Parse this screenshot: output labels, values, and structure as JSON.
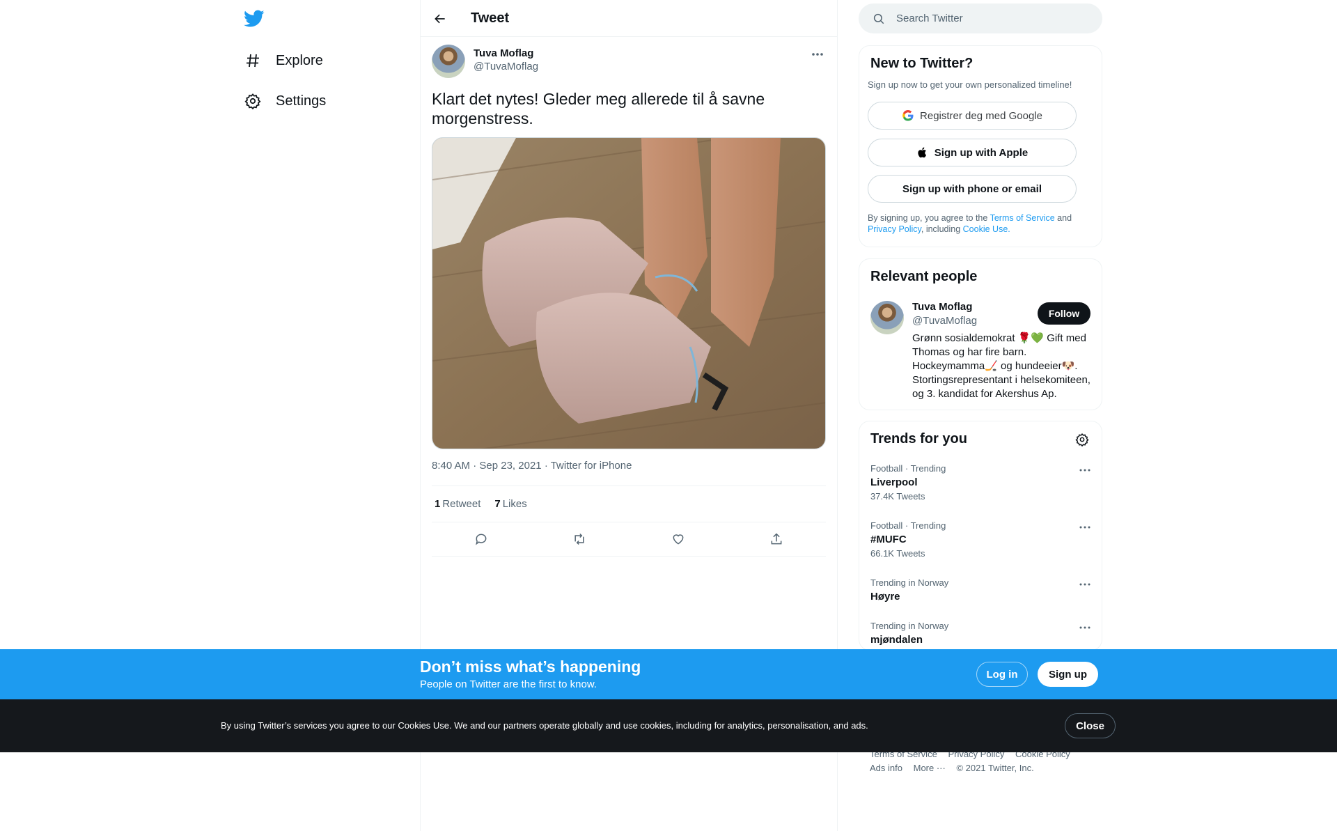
{
  "nav": {
    "explore_label": "Explore",
    "settings_label": "Settings"
  },
  "header": {
    "title": "Tweet"
  },
  "tweet": {
    "author_name": "Tuva Moflag",
    "author_handle": "@TuvaMoflag",
    "text": "Klart det nytes! Gleder meg allerede til å savne morgenstress.",
    "time": "8:40 AM",
    "date": "Sep 23, 2021",
    "source": "Twitter for iPhone",
    "separator": "·",
    "retweets_count": "1",
    "retweets_label": "Retweet",
    "likes_count": "7",
    "likes_label": "Likes"
  },
  "search": {
    "placeholder": "Search Twitter"
  },
  "new_to_twitter": {
    "title": "New to Twitter?",
    "subtitle": "Sign up now to get your own personalized timeline!",
    "google_label": "Registrer deg med Google",
    "apple_label": "Sign up with Apple",
    "phone_label": "Sign up with phone or email",
    "legal_prefix": "By signing up, you agree to the",
    "terms_link": "Terms of Service",
    "legal_and": "and",
    "privacy_link": "Privacy Policy",
    "legal_including": ", including",
    "cookie_link": "Cookie Use."
  },
  "relevant_people": {
    "title": "Relevant people",
    "name": "Tuva Moflag",
    "handle": "@TuvaMoflag",
    "follow_label": "Follow",
    "bio": "Grønn sosialdemokrat 🌹💚 Gift med Thomas og har fire barn. Hockeymamma🏒 og hundeeier🐶. Stortingsrepresentant i helsekomiteen, og 3. kandidat for Akershus Ap."
  },
  "trends": {
    "title": "Trends for you",
    "items": [
      {
        "context": "Football · Trending",
        "name": "Liverpool",
        "count": "37.4K Tweets"
      },
      {
        "context": "Football · Trending",
        "name": "#MUFC",
        "count": "66.1K Tweets"
      },
      {
        "context": "Trending in Norway",
        "name": "Høyre",
        "count": ""
      },
      {
        "context": "Trending in Norway",
        "name": "mjøndalen",
        "count": ""
      }
    ]
  },
  "footer": {
    "terms": "Terms of Service",
    "privacy": "Privacy Policy",
    "cookie": "Cookie Policy",
    "ads": "Ads info",
    "more": "More ···",
    "copyright": "© 2021 Twitter, Inc."
  },
  "banner": {
    "title": "Don’t miss what’s happening",
    "subtitle": "People on Twitter are the first to know.",
    "login_label": "Log in",
    "signup_label": "Sign up"
  },
  "cookie_bar": {
    "text": "By using Twitter’s services you agree to our Cookies Use. We and our partners operate globally and use cookies, including for analytics, personalisation, and ads.",
    "close_label": "Close"
  },
  "colors": {
    "brand_blue": "#1d9bf0",
    "text_primary": "#0f1419",
    "text_secondary": "#536471",
    "cookie_bg": "#15181c"
  },
  "icons": {
    "logo": "twitter-bird-icon",
    "explore": "hashtag-icon",
    "settings": "gear-icon",
    "back": "arrow-left-icon",
    "more": "more-dots-icon",
    "reply": "reply-icon",
    "retweet": "retweet-icon",
    "like": "heart-icon",
    "share": "share-icon",
    "search": "search-icon",
    "google": "google-icon",
    "apple": "apple-icon"
  }
}
